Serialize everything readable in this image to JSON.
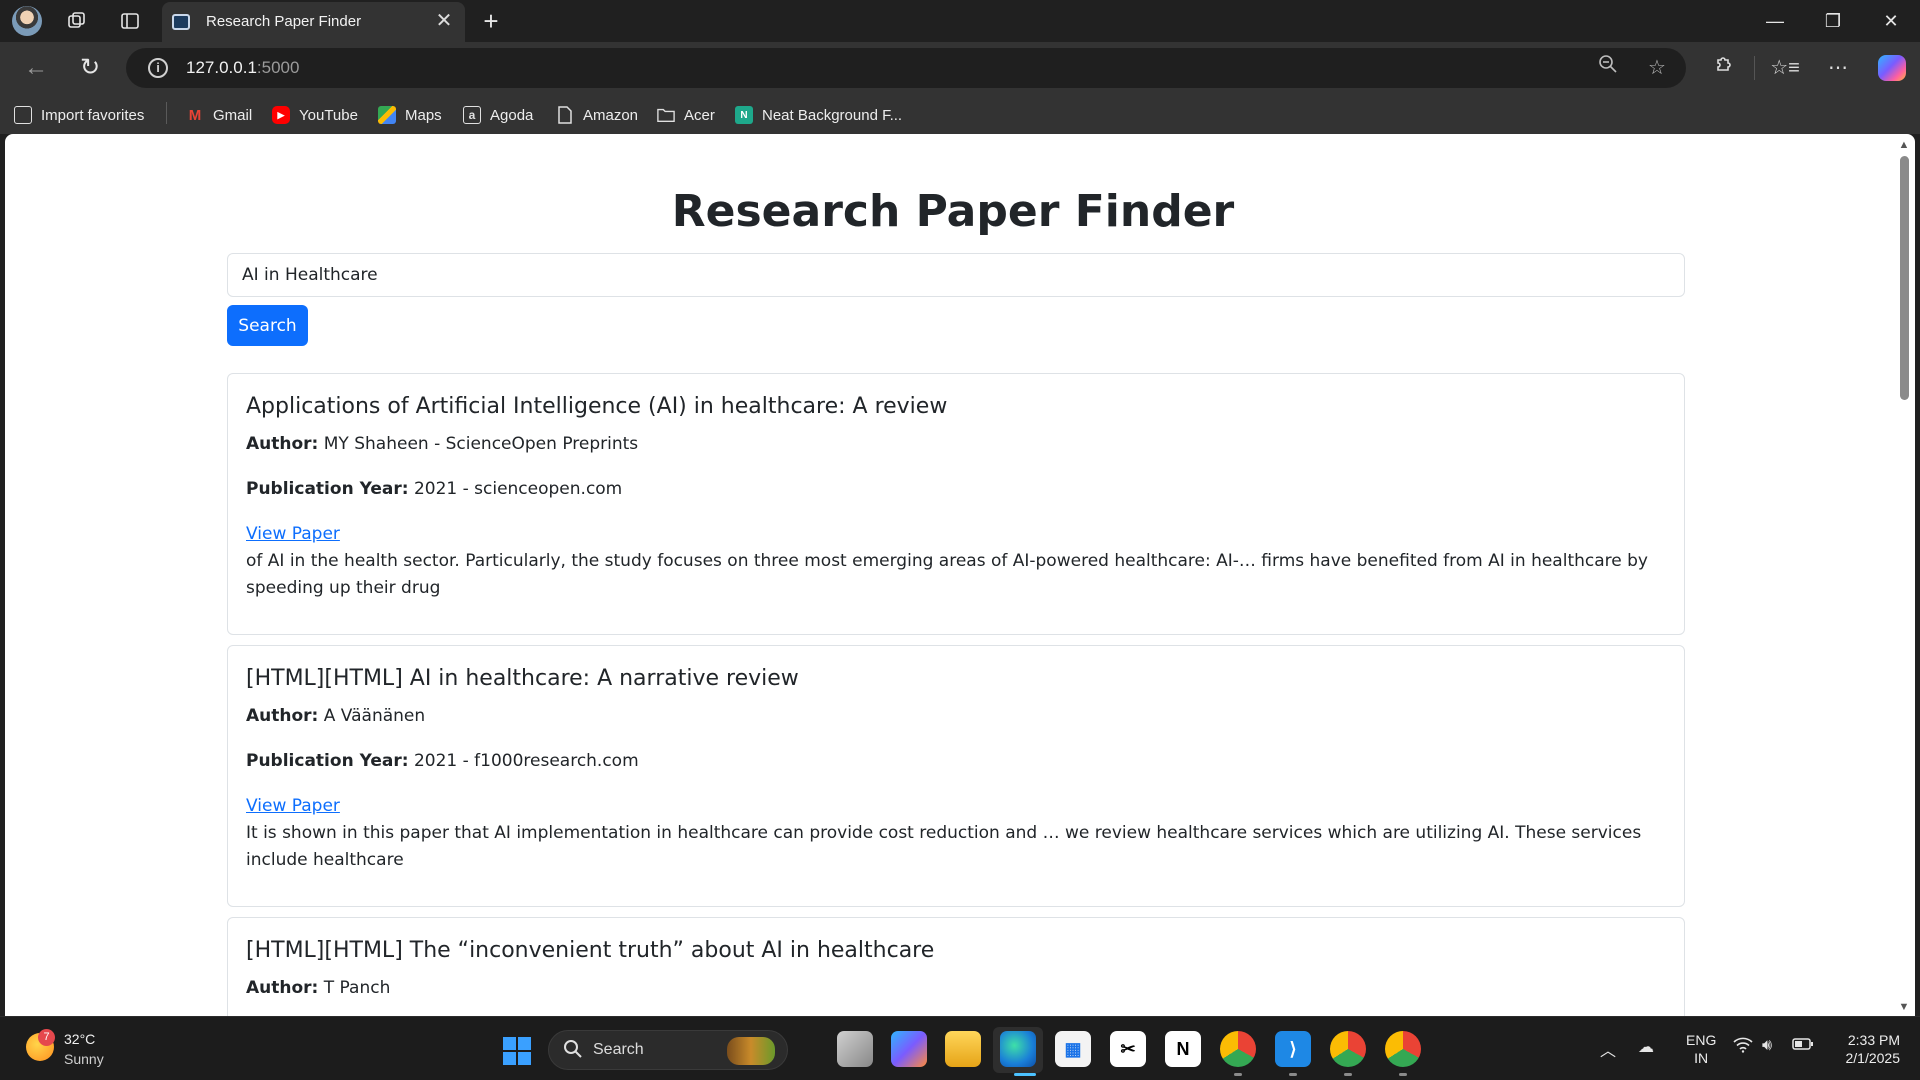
{
  "browser": {
    "tab_title": "Research Paper Finder",
    "tab_close": "✕",
    "new_tab": "+",
    "url_host": "127.0.0.1",
    "url_port": ":5000",
    "favorites": [
      {
        "label": "Import favorites",
        "icon": "import-icon"
      },
      {
        "label": "Gmail",
        "icon": "gmail-icon"
      },
      {
        "label": "YouTube",
        "icon": "youtube-icon"
      },
      {
        "label": "Maps",
        "icon": "maps-icon"
      },
      {
        "label": "Agoda",
        "icon": "agoda-icon"
      },
      {
        "label": "Amazon",
        "icon": "document-icon"
      },
      {
        "label": "Acer",
        "icon": "folder-icon"
      },
      {
        "label": "Neat Background F...",
        "icon": "neat-icon"
      }
    ]
  },
  "page": {
    "title": "Research Paper Finder",
    "search_value": "AI in Healthcare",
    "search_button": "Search",
    "labels": {
      "author": "Author:",
      "year": "Publication Year:",
      "view": "View Paper"
    },
    "results": [
      {
        "title": "Applications of Artificial Intelligence (AI) in healthcare: A review",
        "author": "MY Shaheen - ScienceOpen Preprints",
        "year": "2021 - scienceopen.com",
        "snippet": "of AI in the health sector. Particularly, the study focuses on three most emerging areas of AI-powered healthcare: AI-… firms have benefited from AI in healthcare by speeding up their drug"
      },
      {
        "title": "[HTML][HTML] AI in healthcare: A narrative review",
        "author": "A Väänänen",
        "year": "2021 - f1000research.com",
        "snippet": "It is shown in this paper that AI implementation in healthcare can provide cost reduction and … we review healthcare services which are utilizing AI. These services include healthcare"
      },
      {
        "title": "[HTML][HTML] The “inconvenient truth” about AI in healthcare",
        "author": "T Panch"
      }
    ]
  },
  "taskbar": {
    "weather_temp": "32°C",
    "weather_desc": "Sunny",
    "weather_badge": "7",
    "search_label": "Search",
    "lang_line1": "ENG",
    "lang_line2": "IN",
    "time": "2:33 PM",
    "date": "2/1/2025"
  },
  "colors": {
    "accent": "#0d6efd",
    "link": "#0d6efd",
    "chrome_bg": "#202020",
    "toolbar_bg": "#333333"
  }
}
